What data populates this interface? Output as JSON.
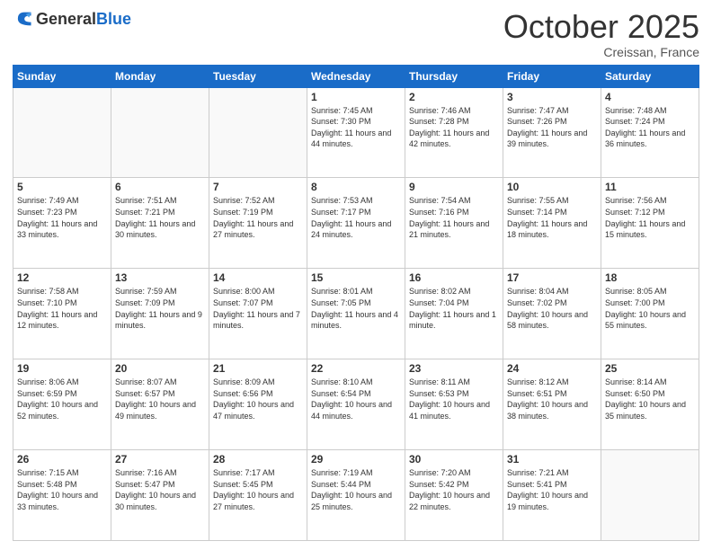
{
  "header": {
    "logo_general": "General",
    "logo_blue": "Blue",
    "month_year": "October 2025",
    "location": "Creissan, France"
  },
  "weekdays": [
    "Sunday",
    "Monday",
    "Tuesday",
    "Wednesday",
    "Thursday",
    "Friday",
    "Saturday"
  ],
  "weeks": [
    [
      {
        "day": "",
        "sunrise": "",
        "sunset": "",
        "daylight": ""
      },
      {
        "day": "",
        "sunrise": "",
        "sunset": "",
        "daylight": ""
      },
      {
        "day": "",
        "sunrise": "",
        "sunset": "",
        "daylight": ""
      },
      {
        "day": "1",
        "sunrise": "Sunrise: 7:45 AM",
        "sunset": "Sunset: 7:30 PM",
        "daylight": "Daylight: 11 hours and 44 minutes."
      },
      {
        "day": "2",
        "sunrise": "Sunrise: 7:46 AM",
        "sunset": "Sunset: 7:28 PM",
        "daylight": "Daylight: 11 hours and 42 minutes."
      },
      {
        "day": "3",
        "sunrise": "Sunrise: 7:47 AM",
        "sunset": "Sunset: 7:26 PM",
        "daylight": "Daylight: 11 hours and 39 minutes."
      },
      {
        "day": "4",
        "sunrise": "Sunrise: 7:48 AM",
        "sunset": "Sunset: 7:24 PM",
        "daylight": "Daylight: 11 hours and 36 minutes."
      }
    ],
    [
      {
        "day": "5",
        "sunrise": "Sunrise: 7:49 AM",
        "sunset": "Sunset: 7:23 PM",
        "daylight": "Daylight: 11 hours and 33 minutes."
      },
      {
        "day": "6",
        "sunrise": "Sunrise: 7:51 AM",
        "sunset": "Sunset: 7:21 PM",
        "daylight": "Daylight: 11 hours and 30 minutes."
      },
      {
        "day": "7",
        "sunrise": "Sunrise: 7:52 AM",
        "sunset": "Sunset: 7:19 PM",
        "daylight": "Daylight: 11 hours and 27 minutes."
      },
      {
        "day": "8",
        "sunrise": "Sunrise: 7:53 AM",
        "sunset": "Sunset: 7:17 PM",
        "daylight": "Daylight: 11 hours and 24 minutes."
      },
      {
        "day": "9",
        "sunrise": "Sunrise: 7:54 AM",
        "sunset": "Sunset: 7:16 PM",
        "daylight": "Daylight: 11 hours and 21 minutes."
      },
      {
        "day": "10",
        "sunrise": "Sunrise: 7:55 AM",
        "sunset": "Sunset: 7:14 PM",
        "daylight": "Daylight: 11 hours and 18 minutes."
      },
      {
        "day": "11",
        "sunrise": "Sunrise: 7:56 AM",
        "sunset": "Sunset: 7:12 PM",
        "daylight": "Daylight: 11 hours and 15 minutes."
      }
    ],
    [
      {
        "day": "12",
        "sunrise": "Sunrise: 7:58 AM",
        "sunset": "Sunset: 7:10 PM",
        "daylight": "Daylight: 11 hours and 12 minutes."
      },
      {
        "day": "13",
        "sunrise": "Sunrise: 7:59 AM",
        "sunset": "Sunset: 7:09 PM",
        "daylight": "Daylight: 11 hours and 9 minutes."
      },
      {
        "day": "14",
        "sunrise": "Sunrise: 8:00 AM",
        "sunset": "Sunset: 7:07 PM",
        "daylight": "Daylight: 11 hours and 7 minutes."
      },
      {
        "day": "15",
        "sunrise": "Sunrise: 8:01 AM",
        "sunset": "Sunset: 7:05 PM",
        "daylight": "Daylight: 11 hours and 4 minutes."
      },
      {
        "day": "16",
        "sunrise": "Sunrise: 8:02 AM",
        "sunset": "Sunset: 7:04 PM",
        "daylight": "Daylight: 11 hours and 1 minute."
      },
      {
        "day": "17",
        "sunrise": "Sunrise: 8:04 AM",
        "sunset": "Sunset: 7:02 PM",
        "daylight": "Daylight: 10 hours and 58 minutes."
      },
      {
        "day": "18",
        "sunrise": "Sunrise: 8:05 AM",
        "sunset": "Sunset: 7:00 PM",
        "daylight": "Daylight: 10 hours and 55 minutes."
      }
    ],
    [
      {
        "day": "19",
        "sunrise": "Sunrise: 8:06 AM",
        "sunset": "Sunset: 6:59 PM",
        "daylight": "Daylight: 10 hours and 52 minutes."
      },
      {
        "day": "20",
        "sunrise": "Sunrise: 8:07 AM",
        "sunset": "Sunset: 6:57 PM",
        "daylight": "Daylight: 10 hours and 49 minutes."
      },
      {
        "day": "21",
        "sunrise": "Sunrise: 8:09 AM",
        "sunset": "Sunset: 6:56 PM",
        "daylight": "Daylight: 10 hours and 47 minutes."
      },
      {
        "day": "22",
        "sunrise": "Sunrise: 8:10 AM",
        "sunset": "Sunset: 6:54 PM",
        "daylight": "Daylight: 10 hours and 44 minutes."
      },
      {
        "day": "23",
        "sunrise": "Sunrise: 8:11 AM",
        "sunset": "Sunset: 6:53 PM",
        "daylight": "Daylight: 10 hours and 41 minutes."
      },
      {
        "day": "24",
        "sunrise": "Sunrise: 8:12 AM",
        "sunset": "Sunset: 6:51 PM",
        "daylight": "Daylight: 10 hours and 38 minutes."
      },
      {
        "day": "25",
        "sunrise": "Sunrise: 8:14 AM",
        "sunset": "Sunset: 6:50 PM",
        "daylight": "Daylight: 10 hours and 35 minutes."
      }
    ],
    [
      {
        "day": "26",
        "sunrise": "Sunrise: 7:15 AM",
        "sunset": "Sunset: 5:48 PM",
        "daylight": "Daylight: 10 hours and 33 minutes."
      },
      {
        "day": "27",
        "sunrise": "Sunrise: 7:16 AM",
        "sunset": "Sunset: 5:47 PM",
        "daylight": "Daylight: 10 hours and 30 minutes."
      },
      {
        "day": "28",
        "sunrise": "Sunrise: 7:17 AM",
        "sunset": "Sunset: 5:45 PM",
        "daylight": "Daylight: 10 hours and 27 minutes."
      },
      {
        "day": "29",
        "sunrise": "Sunrise: 7:19 AM",
        "sunset": "Sunset: 5:44 PM",
        "daylight": "Daylight: 10 hours and 25 minutes."
      },
      {
        "day": "30",
        "sunrise": "Sunrise: 7:20 AM",
        "sunset": "Sunset: 5:42 PM",
        "daylight": "Daylight: 10 hours and 22 minutes."
      },
      {
        "day": "31",
        "sunrise": "Sunrise: 7:21 AM",
        "sunset": "Sunset: 5:41 PM",
        "daylight": "Daylight: 10 hours and 19 minutes."
      },
      {
        "day": "",
        "sunrise": "",
        "sunset": "",
        "daylight": ""
      }
    ]
  ]
}
